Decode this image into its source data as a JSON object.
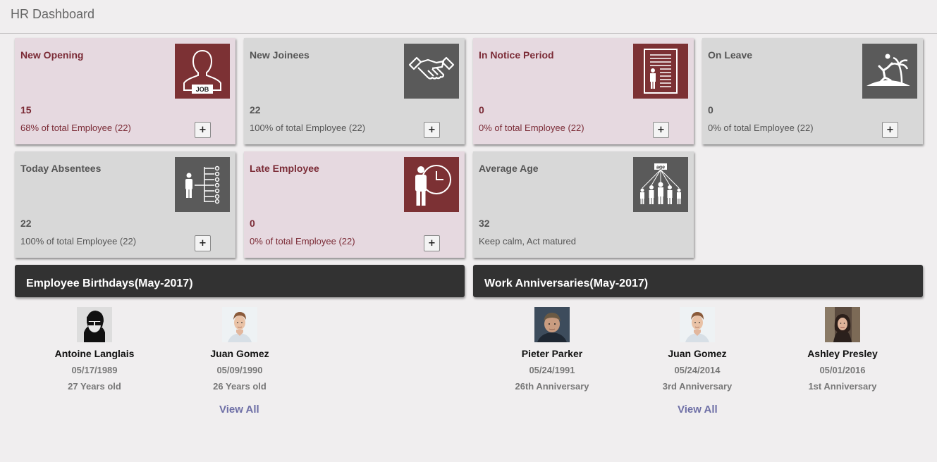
{
  "header": {
    "title": "HR Dashboard"
  },
  "cards": [
    {
      "label": "New Opening",
      "value": "15",
      "sub": "68% of total Employee (22)",
      "plus": "+",
      "icon": "job-icon",
      "theme": "pink"
    },
    {
      "label": "New Joinees",
      "value": "22",
      "sub": "100% of total Employee (22)",
      "plus": "+",
      "icon": "handshake-icon",
      "theme": "grey"
    },
    {
      "label": "In Notice Period",
      "value": "0",
      "sub": "0% of total Employee (22)",
      "plus": "+",
      "icon": "notice-document-icon",
      "theme": "pink"
    },
    {
      "label": "On Leave",
      "value": "0",
      "sub": "0% of total Employee (22)",
      "plus": "+",
      "icon": "vacation-island-icon",
      "theme": "grey"
    },
    {
      "label": "Today Absentees",
      "value": "22",
      "sub": "100% of total Employee (22)",
      "plus": "+",
      "icon": "attendance-list-icon",
      "theme": "grey"
    },
    {
      "label": "Late Employee",
      "value": "0",
      "sub": "0% of total Employee (22)",
      "plus": "+",
      "icon": "person-clock-icon",
      "theme": "pink"
    },
    {
      "label": "Average Age",
      "value": "32",
      "sub": "Keep calm, Act matured",
      "icon": "age-group-icon",
      "icon_text": "age",
      "theme": "grey"
    }
  ],
  "birthdays": {
    "title": "Employee Birthdays(May-2017)",
    "people": [
      {
        "name": "Antoine Langlais",
        "date": "05/17/1989",
        "extra": "27 Years old"
      },
      {
        "name": "Juan Gomez",
        "date": "05/09/1990",
        "extra": "26 Years old"
      }
    ],
    "view_all": "View All"
  },
  "anniversaries": {
    "title": "Work Anniversaries(May-2017)",
    "people": [
      {
        "name": "Pieter Parker",
        "date": "05/24/1991",
        "extra": "26th Anniversary"
      },
      {
        "name": "Juan Gomez",
        "date": "05/24/2014",
        "extra": "3rd Anniversary"
      },
      {
        "name": "Ashley Presley",
        "date": "05/01/2016",
        "extra": "1st Anniversary"
      }
    ],
    "view_all": "View All"
  },
  "colors": {
    "pink_card": "#e6d9e0",
    "grey_card": "#d8d8d8",
    "maroon": "#7c3134",
    "dark_grey": "#5a5a5a",
    "panel_head": "#323232",
    "link": "#6e6fa6"
  }
}
